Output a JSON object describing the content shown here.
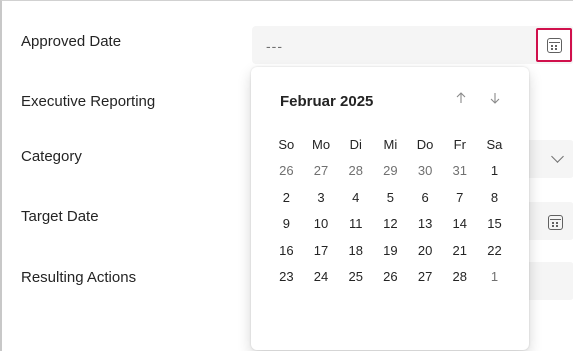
{
  "form": {
    "approved_date": {
      "label": "Approved Date",
      "value": "---"
    },
    "executive_reporting": {
      "label": "Executive Reporting"
    },
    "category": {
      "label": "Category"
    },
    "target_date": {
      "label": "Target Date"
    },
    "resulting_actions": {
      "label": "Resulting Actions"
    }
  },
  "datepicker": {
    "month_label": "Februar 2025",
    "prev_icon": "arrow-up-icon",
    "next_icon": "arrow-down-icon",
    "weekdays": [
      "So",
      "Mo",
      "Di",
      "Mi",
      "Do",
      "Fr",
      "Sa"
    ],
    "weeks": [
      [
        {
          "d": "26",
          "out": true
        },
        {
          "d": "27",
          "out": true
        },
        {
          "d": "28",
          "out": true
        },
        {
          "d": "29",
          "out": true
        },
        {
          "d": "30",
          "out": true
        },
        {
          "d": "31",
          "out": true
        },
        {
          "d": "1",
          "out": false
        }
      ],
      [
        {
          "d": "2",
          "out": false
        },
        {
          "d": "3",
          "out": false
        },
        {
          "d": "4",
          "out": false
        },
        {
          "d": "5",
          "out": false
        },
        {
          "d": "6",
          "out": false
        },
        {
          "d": "7",
          "out": false
        },
        {
          "d": "8",
          "out": false
        }
      ],
      [
        {
          "d": "9",
          "out": false
        },
        {
          "d": "10",
          "out": false
        },
        {
          "d": "11",
          "out": false
        },
        {
          "d": "12",
          "out": false
        },
        {
          "d": "13",
          "out": false
        },
        {
          "d": "14",
          "out": false
        },
        {
          "d": "15",
          "out": false
        }
      ],
      [
        {
          "d": "16",
          "out": false
        },
        {
          "d": "17",
          "out": false
        },
        {
          "d": "18",
          "out": false
        },
        {
          "d": "19",
          "out": false
        },
        {
          "d": "20",
          "out": false
        },
        {
          "d": "21",
          "out": false
        },
        {
          "d": "22",
          "out": false
        }
      ],
      [
        {
          "d": "23",
          "out": false
        },
        {
          "d": "24",
          "out": false
        },
        {
          "d": "25",
          "out": false
        },
        {
          "d": "26",
          "out": false
        },
        {
          "d": "27",
          "out": false
        },
        {
          "d": "28",
          "out": false
        },
        {
          "d": "1",
          "out": true
        }
      ]
    ]
  },
  "colors": {
    "focus_border": "#d0104c",
    "field_bg": "#f5f5f5",
    "muted_text": "#707070"
  }
}
